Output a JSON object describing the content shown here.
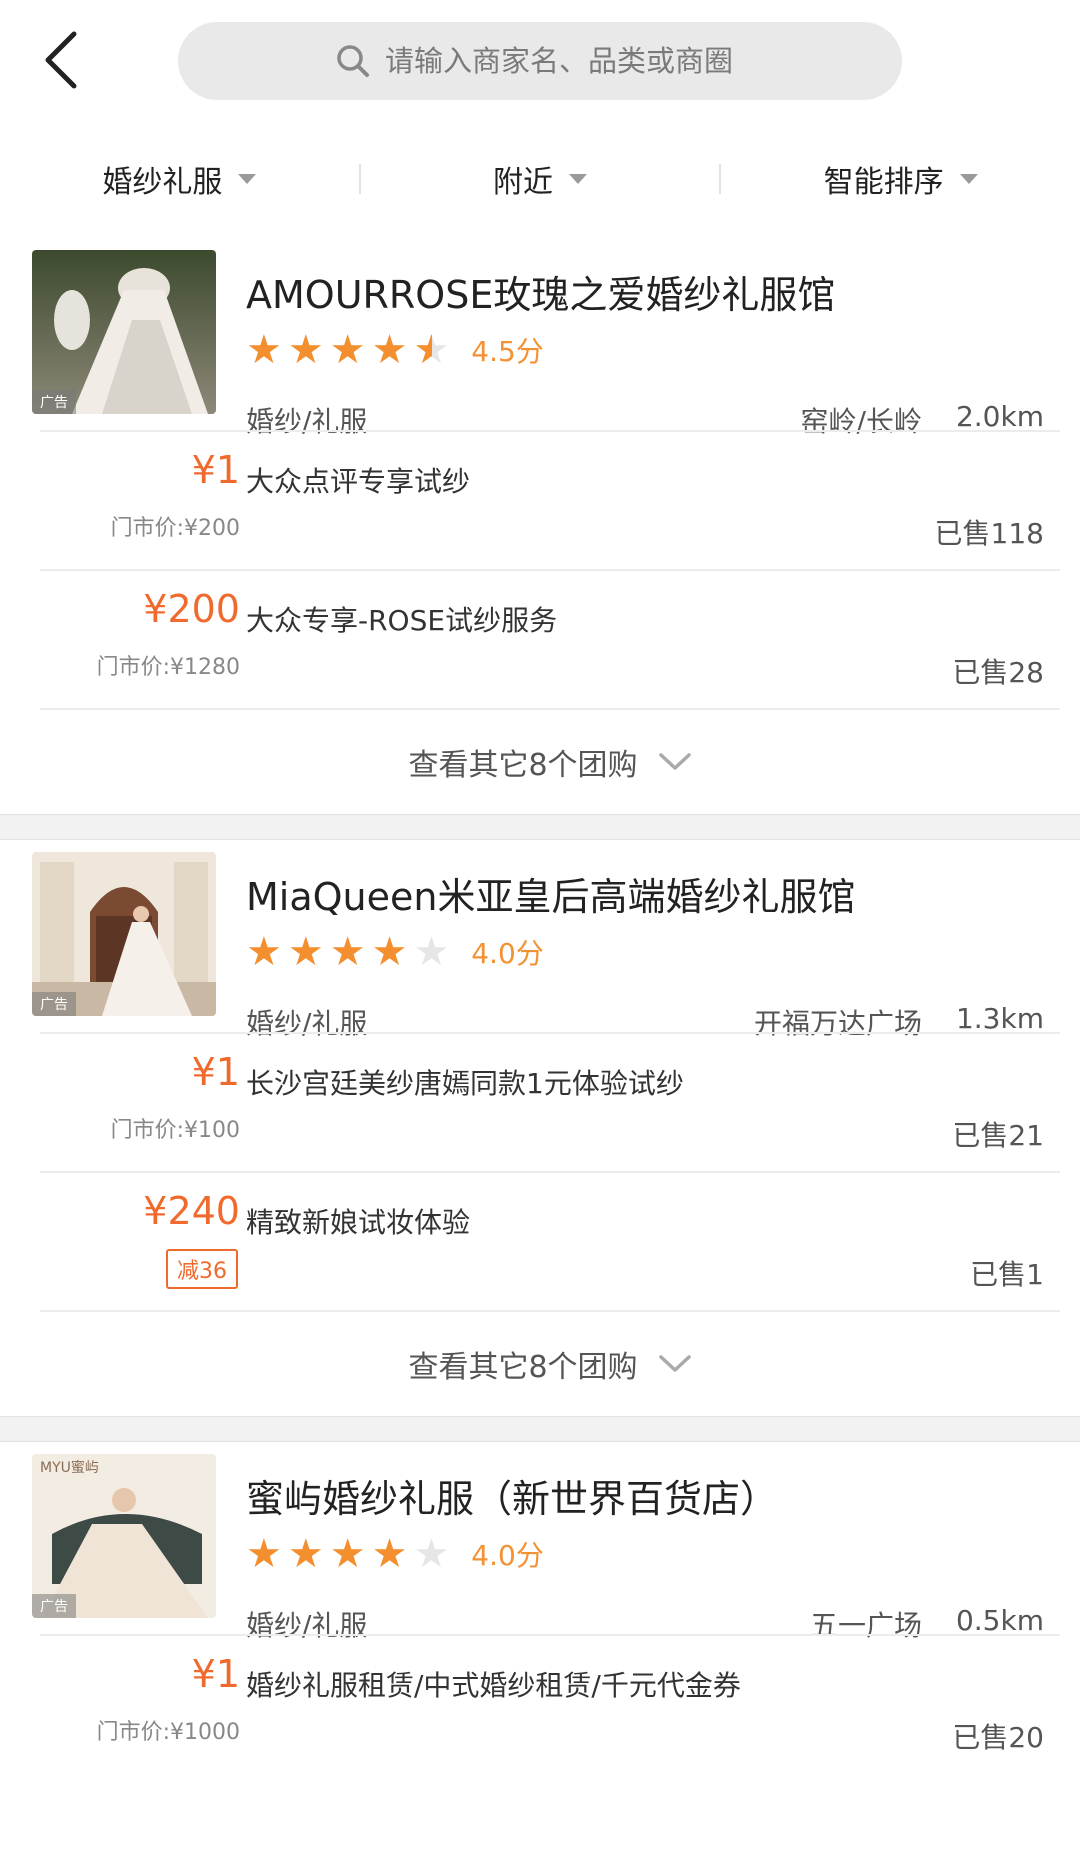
{
  "header": {
    "search_placeholder": "请输入商家名、品类或商圈"
  },
  "filters": [
    {
      "label": "婚纱礼服"
    },
    {
      "label": "附近"
    },
    {
      "label": "智能排序"
    }
  ],
  "shops": [
    {
      "name": "AMOURROSE玫瑰之爱婚纱礼服馆",
      "rating": 4.5,
      "score": "4.5分",
      "category": "婚纱/礼服",
      "area": "窑岭/长岭",
      "distance": "2.0km",
      "ad_tag": "广告",
      "deals": [
        {
          "price": "¥1",
          "market_price": "门市价:¥200",
          "title": "大众点评专享试纱",
          "sold": "已售118"
        },
        {
          "price": "¥200",
          "market_price": "门市价:¥1280",
          "title": "大众专享-ROSE试纱服务",
          "sold": "已售28"
        }
      ],
      "more": "查看其它8个团购"
    },
    {
      "name": "MiaQueen米亚皇后高端婚纱礼服馆",
      "rating": 4.0,
      "score": "4.0分",
      "category": "婚纱/礼服",
      "area": "开福万达广场",
      "distance": "1.3km",
      "ad_tag": "广告",
      "deals": [
        {
          "price": "¥1",
          "market_price": "门市价:¥100",
          "title": "长沙宫廷美纱唐嫣同款1元体验试纱",
          "sold": "已售21"
        },
        {
          "price": "¥240",
          "discount": "减36",
          "title": "精致新娘试妆体验",
          "sold": "已售1"
        }
      ],
      "more": "查看其它8个团购"
    },
    {
      "name": "蜜屿婚纱礼服（新世界百货店）",
      "rating": 4.0,
      "score": "4.0分",
      "category": "婚纱/礼服",
      "area": "五一广场",
      "distance": "0.5km",
      "ad_tag": "广告",
      "thumb_logo": "MYU蜜屿",
      "deals": [
        {
          "price": "¥1",
          "market_price": "门市价:¥1000",
          "title": "婚纱礼服租赁/中式婚纱租赁/千元代金券",
          "sold": "已售20"
        }
      ]
    }
  ]
}
